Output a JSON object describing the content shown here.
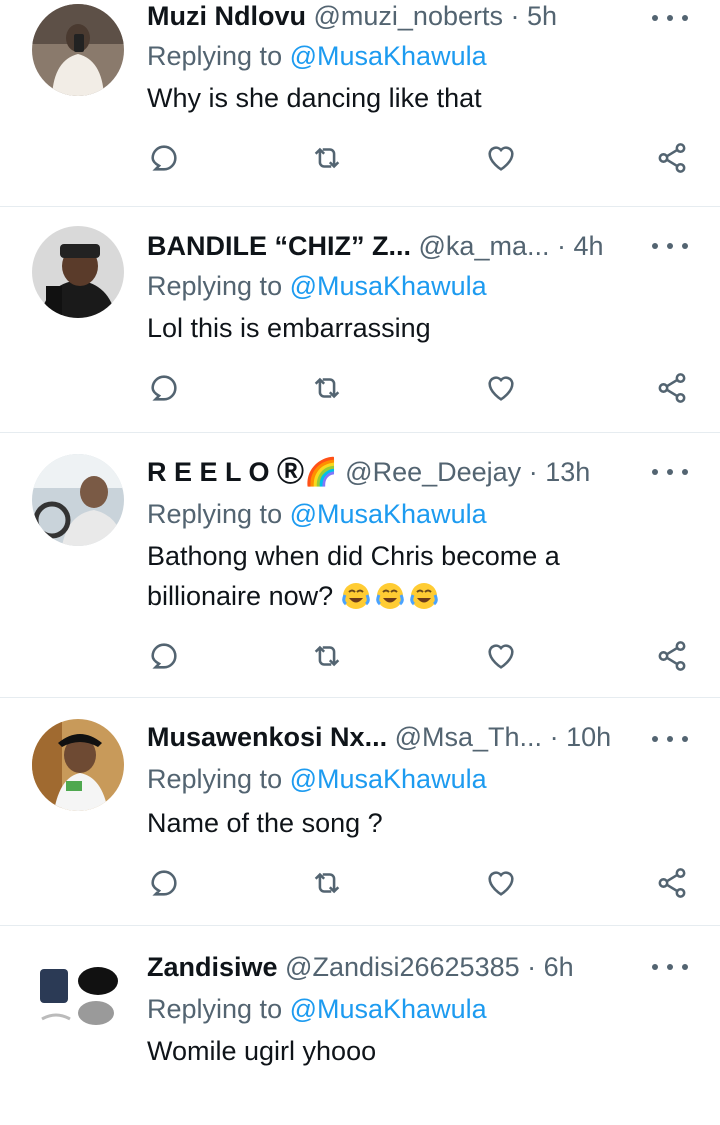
{
  "tweets": [
    {
      "name": "Muzi Ndlovu",
      "handle": "@muzi_noberts",
      "dot": "·",
      "time": "5h",
      "replying_prefix": "Replying to ",
      "replying_to": "@MusaKhawula",
      "text_lines": [
        "Why is she dancing like that"
      ]
    },
    {
      "name": "BANDILE “CHIZ” Z...",
      "handle": "@ka_ma...",
      "dot": "·",
      "time": "4h",
      "replying_prefix": "Replying to ",
      "replying_to": "@MusaKhawula",
      "text_lines": [
        "Lol this is embarrassing"
      ]
    },
    {
      "name": "R E E L O Ⓡ🌈",
      "handle": "@Ree_Deejay",
      "dot": "·",
      "time": "13h",
      "replying_prefix": "Replying to ",
      "replying_to": "@MusaKhawula",
      "text_lines": [
        "Bathong when did Chris become a",
        "billionaire now?"
      ],
      "emojis": [
        "face-with-tears-of-joy",
        "face-with-tears-of-joy",
        "face-with-tears-of-joy"
      ]
    },
    {
      "name": "Musawenkosi Nx...",
      "handle": "@Msa_Th...",
      "dot": "·",
      "time": "10h",
      "replying_prefix": "Replying to ",
      "replying_to": "@MusaKhawula",
      "text_lines": [
        "Name of the song ?"
      ]
    },
    {
      "name": "Zandisiwe",
      "handle": "@Zandisi26625385",
      "dot": "·",
      "time": "6h",
      "replying_prefix": "Replying to ",
      "replying_to": "@MusaKhawula",
      "text_lines": [
        "Womile ugirl yhooo"
      ]
    }
  ],
  "icons": {
    "reply": "reply-icon",
    "retweet": "retweet-icon",
    "like": "like-icon",
    "share": "share-icon",
    "more": "more-icon"
  },
  "colors": {
    "text": "#0f1419",
    "secondary": "#536471",
    "mention": "#1d9bf0",
    "divider": "#e6ecf0"
  }
}
